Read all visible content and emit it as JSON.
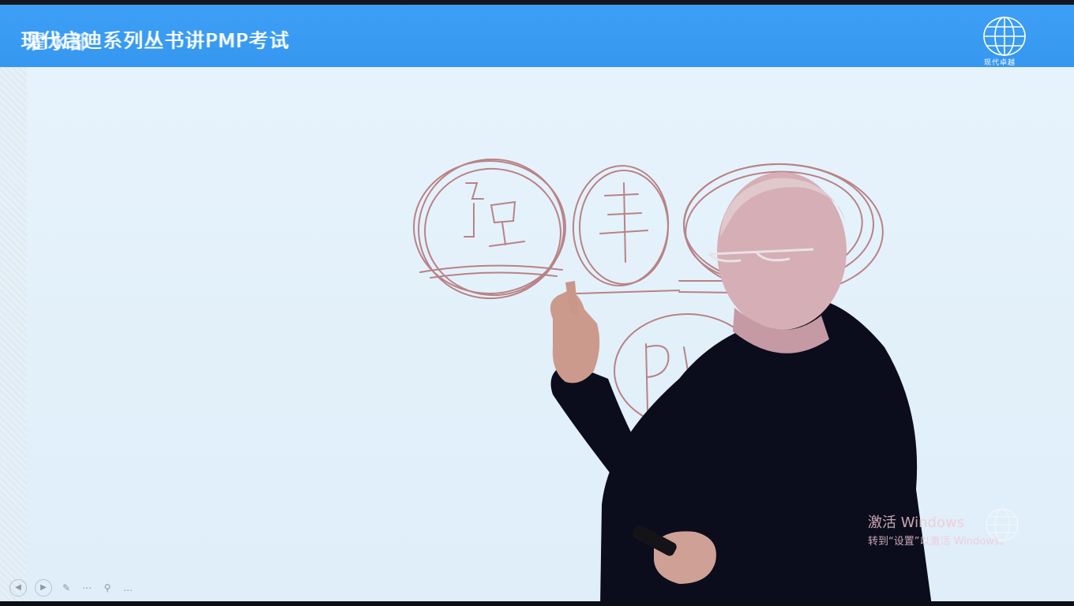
{
  "header": {
    "title": "现代启迪系列丛书讲PMP考试",
    "title_overlay": "濯水部",
    "logo_caption": "现代卓越",
    "bar_color": "#3d9ff5"
  },
  "whiteboard": {
    "ink_color": "#b4777a",
    "handwritten": [
      "强",
      "军",
      "PM"
    ]
  },
  "watermark": {
    "title": "激活 Windows",
    "subtitle": "转到“设置”以激活 Windows。"
  },
  "player_controls": {
    "icons": [
      "prev-slide-icon",
      "next-slide-icon",
      "pen-icon",
      "menu-icon",
      "zoom-icon",
      "more-icon"
    ]
  }
}
